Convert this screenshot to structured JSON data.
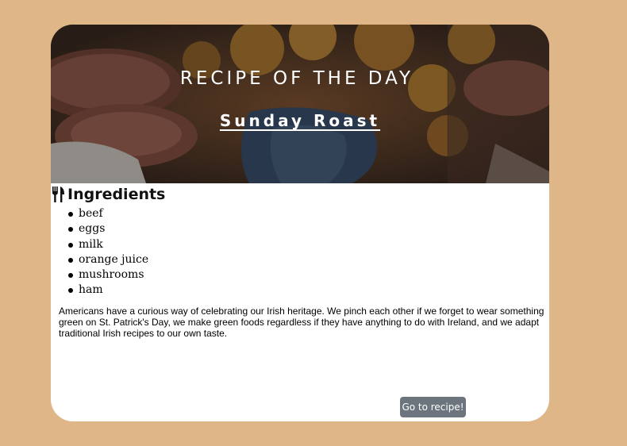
{
  "hero": {
    "title": "RECIPE OF THE DAY",
    "recipe_name": "Sunday Roast",
    "image_description_icon": "roast-dinner-photo"
  },
  "ingredients": {
    "heading": "Ingredients",
    "heading_icon": "fork-knife-icon",
    "items": [
      "beef",
      "eggs",
      "milk",
      "orange juice",
      "mushrooms",
      "ham"
    ]
  },
  "description": "Americans have a curious way of celebrating our Irish heritage. We pinch each other if we forget to wear something green on St. Patrick's Day, we make green foods regardless if they have anything to do with Ireland, and we adapt traditional Irish recipes to our own taste.",
  "cta": {
    "label": "Go to recipe!"
  },
  "colors": {
    "page_background": "#dfb687",
    "card_background": "#ffffff",
    "button_background": "#6c757d",
    "button_text": "#ffffff"
  }
}
